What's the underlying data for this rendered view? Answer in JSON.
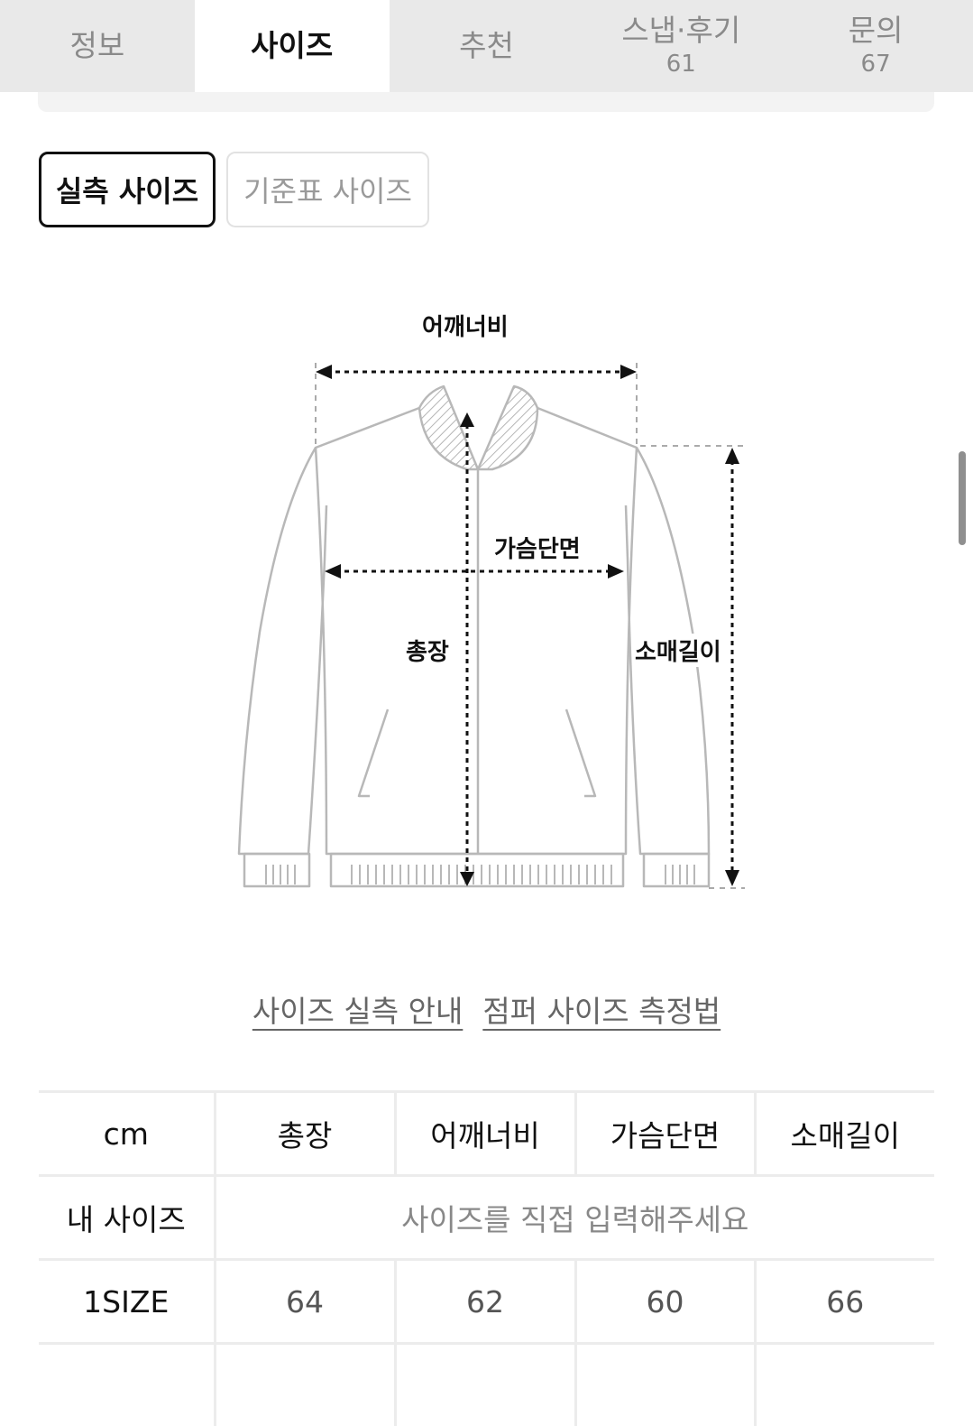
{
  "tabs": [
    {
      "label": "정보",
      "count": ""
    },
    {
      "label": "사이즈",
      "count": ""
    },
    {
      "label": "추천",
      "count": ""
    },
    {
      "label": "스냅·후기",
      "count": "61"
    },
    {
      "label": "문의",
      "count": "67"
    }
  ],
  "size_toggle": {
    "measured": "실측 사이즈",
    "standard": "기준표 사이즈"
  },
  "diagram_labels": {
    "shoulder": "어깨너비",
    "chest": "가슴단면",
    "total_length": "총장",
    "sleeve": "소매길이"
  },
  "guides": {
    "size_guide": "사이즈 실측 안내",
    "jumper_guide": "점퍼 사이즈 측정법"
  },
  "table": {
    "headers": [
      "cm",
      "총장",
      "어깨너비",
      "가슴단면",
      "소매길이"
    ],
    "my_size_label": "내 사이즈",
    "my_size_placeholder": "사이즈를 직접 입력해주세요",
    "rows": [
      {
        "size": "1SIZE",
        "values": [
          "64",
          "62",
          "60",
          "66"
        ]
      }
    ]
  }
}
